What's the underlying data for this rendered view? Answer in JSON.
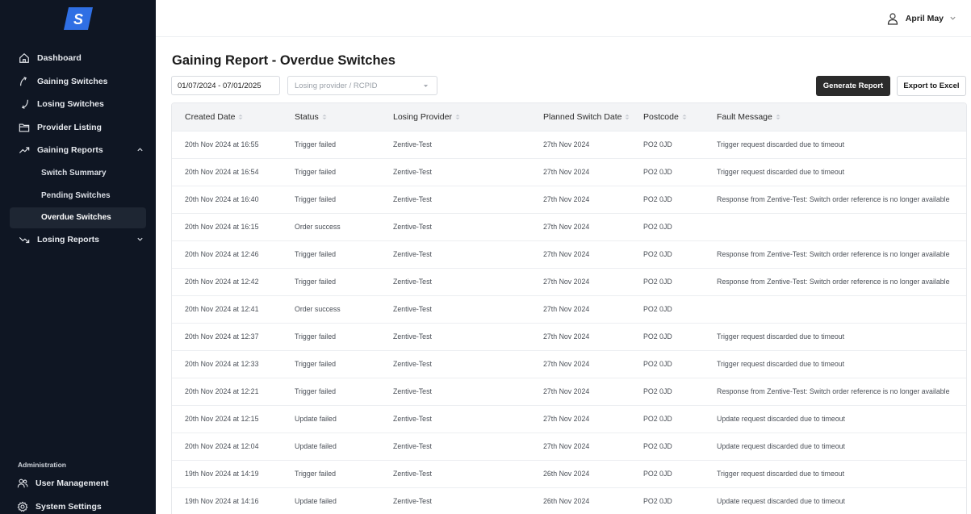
{
  "brand": {
    "logo_letter": "S",
    "accent": "#2f6fe4"
  },
  "sidebar": {
    "items": [
      {
        "label": "Dashboard",
        "icon": "home-icon"
      },
      {
        "label": "Gaining Switches",
        "icon": "arrow-up-curve-icon"
      },
      {
        "label": "Losing Switches",
        "icon": "arrow-down-curve-icon"
      },
      {
        "label": "Provider Listing",
        "icon": "folder-icon"
      },
      {
        "label": "Gaining Reports",
        "icon": "trend-up-icon",
        "expanded": true
      },
      {
        "label": "Losing Reports",
        "icon": "trend-down-icon",
        "expanded": false
      }
    ],
    "gaining_sub": [
      {
        "label": "Switch Summary"
      },
      {
        "label": "Pending Switches"
      },
      {
        "label": "Overdue Switches",
        "active": true
      }
    ],
    "admin_label": "Administration",
    "admin_items": [
      {
        "label": "User Management",
        "icon": "users-icon"
      },
      {
        "label": "System Settings",
        "icon": "gear-icon"
      }
    ]
  },
  "header": {
    "user_name": "April May"
  },
  "page": {
    "title": "Gaining Report - Overdue Switches",
    "date_range": "01/07/2024 - 07/01/2025",
    "provider_placeholder": "Losing provider / RCPID",
    "generate_label": "Generate Report",
    "export_label": "Export to Excel"
  },
  "table": {
    "columns": [
      "Created Date",
      "Status",
      "Losing Provider",
      "Planned Switch Date",
      "Postcode",
      "Fault Message"
    ],
    "rows": [
      [
        "20th Nov 2024 at 16:55",
        "Trigger failed",
        "Zentive-Test",
        "27th Nov 2024",
        "PO2 0JD",
        "Trigger request discarded due to timeout"
      ],
      [
        "20th Nov 2024 at 16:54",
        "Trigger failed",
        "Zentive-Test",
        "27th Nov 2024",
        "PO2 0JD",
        "Trigger request discarded due to timeout"
      ],
      [
        "20th Nov 2024 at 16:40",
        "Trigger failed",
        "Zentive-Test",
        "27th Nov 2024",
        "PO2 0JD",
        "Response from Zentive-Test: Switch order reference is no longer available"
      ],
      [
        "20th Nov 2024 at 16:15",
        "Order success",
        "Zentive-Test",
        "27th Nov 2024",
        "PO2 0JD",
        ""
      ],
      [
        "20th Nov 2024 at 12:46",
        "Trigger failed",
        "Zentive-Test",
        "27th Nov 2024",
        "PO2 0JD",
        "Response from Zentive-Test: Switch order reference is no longer available"
      ],
      [
        "20th Nov 2024 at 12:42",
        "Trigger failed",
        "Zentive-Test",
        "27th Nov 2024",
        "PO2 0JD",
        "Response from Zentive-Test: Switch order reference is no longer available"
      ],
      [
        "20th Nov 2024 at 12:41",
        "Order success",
        "Zentive-Test",
        "27th Nov 2024",
        "PO2 0JD",
        ""
      ],
      [
        "20th Nov 2024 at 12:37",
        "Trigger failed",
        "Zentive-Test",
        "27th Nov 2024",
        "PO2 0JD",
        "Trigger request discarded due to timeout"
      ],
      [
        "20th Nov 2024 at 12:33",
        "Trigger failed",
        "Zentive-Test",
        "27th Nov 2024",
        "PO2 0JD",
        "Trigger request discarded due to timeout"
      ],
      [
        "20th Nov 2024 at 12:21",
        "Trigger failed",
        "Zentive-Test",
        "27th Nov 2024",
        "PO2 0JD",
        "Response from Zentive-Test: Switch order reference is no longer available"
      ],
      [
        "20th Nov 2024 at 12:15",
        "Update failed",
        "Zentive-Test",
        "27th Nov 2024",
        "PO2 0JD",
        "Update request discarded due to timeout"
      ],
      [
        "20th Nov 2024 at 12:04",
        "Update failed",
        "Zentive-Test",
        "27th Nov 2024",
        "PO2 0JD",
        "Update request discarded due to timeout"
      ],
      [
        "19th Nov 2024 at 14:19",
        "Trigger failed",
        "Zentive-Test",
        "26th Nov 2024",
        "PO2 0JD",
        "Trigger request discarded due to timeout"
      ],
      [
        "19th Nov 2024 at 14:16",
        "Update failed",
        "Zentive-Test",
        "26th Nov 2024",
        "PO2 0JD",
        "Update request discarded due to timeout"
      ]
    ]
  }
}
